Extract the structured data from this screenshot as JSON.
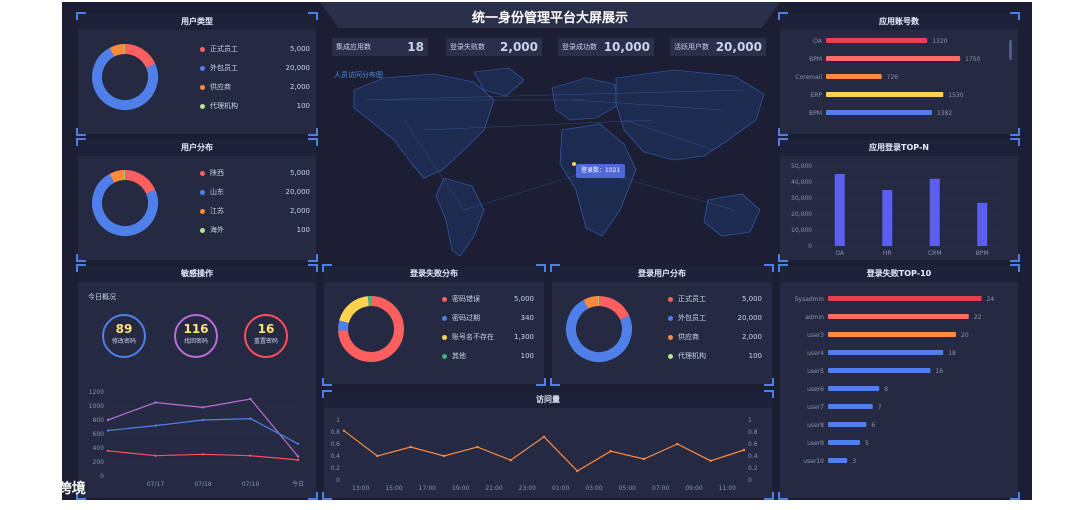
{
  "header": {
    "title": "统一身份管理平台大屏展示"
  },
  "stats": [
    {
      "label": "集成应用数",
      "value": "18",
      "color": "#ff5a5a"
    },
    {
      "label": "登录失败数",
      "value": "2,000",
      "color": "#ff9b3d"
    },
    {
      "label": "登录成功数",
      "value": "10,000",
      "color": "#ffe27a"
    },
    {
      "label": "活跃用户数",
      "value": "20,000",
      "color": "#b7f08a"
    }
  ],
  "map": {
    "label": "人员访问分布图",
    "tooltip": "登录数：1021"
  },
  "user_types": {
    "title": "用户类型",
    "items": [
      {
        "label": "正式员工",
        "value": "5,000",
        "color": "#ff5f5f"
      },
      {
        "label": "外包员工",
        "value": "20,000",
        "color": "#4f7fe8"
      },
      {
        "label": "供应商",
        "value": "2,000",
        "color": "#ff8a3d"
      },
      {
        "label": "代理机构",
        "value": "100",
        "color": "#b7e58c"
      }
    ]
  },
  "user_dist": {
    "title": "用户分布",
    "items": [
      {
        "label": "陕西",
        "value": "5,000",
        "color": "#ff5f5f"
      },
      {
        "label": "山东",
        "value": "20,000",
        "color": "#4f7fe8"
      },
      {
        "label": "江苏",
        "value": "2,000",
        "color": "#ff8a3d"
      },
      {
        "label": "海外",
        "value": "100",
        "color": "#b7e58c"
      }
    ]
  },
  "sensitive": {
    "title": "敏感操作",
    "subtitle": "今日概况",
    "circles": [
      {
        "value": "89",
        "label": "修改密码",
        "color": "#4f7fe8"
      },
      {
        "value": "116",
        "label": "找回密码",
        "color": "#b86fd6"
      },
      {
        "value": "16",
        "label": "重置密码",
        "color": "#ff4d5e"
      }
    ]
  },
  "login_fail_dist": {
    "title": "登录失败分布",
    "items": [
      {
        "label": "密码错误",
        "value": "5,000",
        "color": "#ff5f5f"
      },
      {
        "label": "密码过期",
        "value": "340",
        "color": "#4f7fe8"
      },
      {
        "label": "账号名不存在",
        "value": "1,300",
        "color": "#ffd34d"
      },
      {
        "label": "其他",
        "value": "100",
        "color": "#3fb37f"
      }
    ]
  },
  "login_user_dist": {
    "title": "登录用户分布",
    "items": [
      {
        "label": "正式员工",
        "value": "5,000",
        "color": "#ff5f5f"
      },
      {
        "label": "外包员工",
        "value": "20,000",
        "color": "#4f7fe8"
      },
      {
        "label": "供应商",
        "value": "2,000",
        "color": "#ff8a3d"
      },
      {
        "label": "代理机构",
        "value": "100",
        "color": "#b7e58c"
      }
    ]
  },
  "visits": {
    "title": "访问量"
  },
  "app_accounts": {
    "title": "应用账号数"
  },
  "app_login_top": {
    "title": "应用登录TOP-N"
  },
  "login_fail_top": {
    "title": "登录失败TOP-10"
  },
  "brand": {
    "logo": "ι©°",
    "name": "大数跨境"
  },
  "chart_data": [
    {
      "type": "pie",
      "categories": [
        "正式员工",
        "外包员工",
        "供应商",
        "代理机构"
      ],
      "values": [
        5000,
        20000,
        2000,
        100
      ]
    },
    {
      "type": "pie",
      "categories": [
        "陕西",
        "山东",
        "江苏",
        "海外"
      ],
      "values": [
        5000,
        20000,
        2000,
        100
      ]
    },
    {
      "type": "line",
      "categories": [
        "07/17",
        "07/18",
        "07/19",
        "今日"
      ],
      "ylim": [
        0,
        1200
      ],
      "yticks": [
        0,
        200,
        400,
        600,
        800,
        1000,
        1200
      ],
      "series": [
        {
          "color": "#b86fd6",
          "values": [
            800,
            1050,
            980,
            1100,
            280
          ]
        },
        {
          "color": "#4f7fe8",
          "values": [
            650,
            720,
            800,
            820,
            460
          ]
        },
        {
          "color": "#ff4d5e",
          "values": [
            360,
            290,
            310,
            290,
            230
          ]
        }
      ]
    },
    {
      "type": "pie",
      "categories": [
        "密码错误",
        "密码过期",
        "账号名不存在",
        "其他"
      ],
      "values": [
        5000,
        340,
        1300,
        100
      ]
    },
    {
      "type": "pie",
      "categories": [
        "正式员工",
        "外包员工",
        "供应商",
        "代理机构"
      ],
      "values": [
        5000,
        20000,
        2000,
        100
      ]
    },
    {
      "type": "line",
      "categories": [
        "13:00",
        "15:00",
        "17:00",
        "19:00",
        "21:00",
        "23:00",
        "01:00",
        "03:00",
        "05:00",
        "07:00",
        "09:00",
        "11:00"
      ],
      "ylim": [
        0,
        1
      ],
      "yticks": [
        0,
        0.2,
        0.4,
        0.6,
        0.8,
        1
      ],
      "series": [
        {
          "color": "#ff8a3d",
          "values": [
            0.82,
            0.4,
            0.55,
            0.4,
            0.55,
            0.33,
            0.72,
            0.15,
            0.48,
            0.35,
            0.6,
            0.32,
            0.5
          ]
        }
      ]
    },
    {
      "type": "bar",
      "orientation": "horizontal",
      "categories": [
        "OA",
        "BPM",
        "Coremail",
        "ERP",
        "BPM"
      ],
      "values": [
        1320,
        1750,
        726,
        1530,
        1382
      ],
      "colors": [
        "#e8414e",
        "#ff6b6b",
        "#ff8a3d",
        "#ffd34d",
        "#4f7fe8"
      ]
    },
    {
      "type": "bar",
      "categories": [
        "OA",
        "HR",
        "CRM",
        "BPM"
      ],
      "values": [
        45000,
        35000,
        42000,
        27000
      ],
      "ylim": [
        0,
        50000
      ],
      "yticks": [
        0,
        10000,
        20000,
        30000,
        40000,
        50000
      ]
    },
    {
      "type": "bar",
      "orientation": "horizontal",
      "categories": [
        "Sysadmin",
        "admin",
        "user3",
        "user4",
        "user5",
        "user6",
        "user7",
        "user8",
        "user9",
        "user10"
      ],
      "values": [
        24,
        22,
        20,
        18,
        16,
        8,
        7,
        6,
        5,
        3
      ],
      "colors": [
        "#e8414e",
        "#ff6b6b",
        "#ff8a3d",
        "#4f7fe8",
        "#4f7fe8",
        "#4f7fe8",
        "#4f7fe8",
        "#4f7fe8",
        "#4f7fe8",
        "#4f7fe8"
      ]
    }
  ]
}
